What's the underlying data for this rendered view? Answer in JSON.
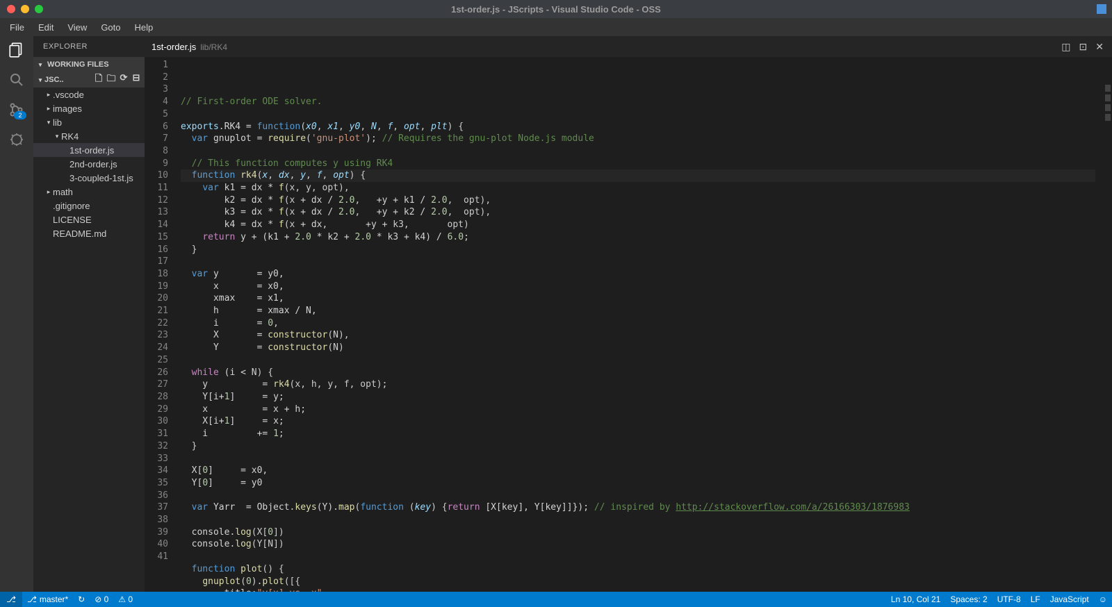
{
  "os_title": "1st-order.js - JScripts - Visual Studio Code - OSS",
  "menu": [
    "File",
    "Edit",
    "View",
    "Goto",
    "Help"
  ],
  "activity_badge": "2",
  "sidebar": {
    "title": "EXPLORER",
    "working_files": "WORKING FILES",
    "root_name": "JSC..",
    "tree": [
      {
        "label": ".vscode",
        "depth": 1,
        "tw": "▸",
        "sel": false
      },
      {
        "label": "images",
        "depth": 1,
        "tw": "▸",
        "sel": false
      },
      {
        "label": "lib",
        "depth": 1,
        "tw": "▾",
        "sel": false
      },
      {
        "label": "RK4",
        "depth": 2,
        "tw": "▾",
        "sel": false
      },
      {
        "label": "1st-order.js",
        "depth": 3,
        "tw": "",
        "sel": true
      },
      {
        "label": "2nd-order.js",
        "depth": 3,
        "tw": "",
        "sel": false
      },
      {
        "label": "3-coupled-1st.js",
        "depth": 3,
        "tw": "",
        "sel": false
      },
      {
        "label": "math",
        "depth": 1,
        "tw": "▸",
        "sel": false
      },
      {
        "label": ".gitignore",
        "depth": 1,
        "tw": "",
        "sel": false
      },
      {
        "label": "LICENSE",
        "depth": 1,
        "tw": "",
        "sel": false
      },
      {
        "label": "README.md",
        "depth": 1,
        "tw": "",
        "sel": false
      }
    ]
  },
  "tab": {
    "name": "1st-order.js",
    "path": "lib/RK4"
  },
  "highlight_line": 10,
  "code_lines": 41,
  "code": [
    [
      {
        "t": "// First-order ODE solver.",
        "c": "c-comment"
      }
    ],
    [],
    [
      {
        "t": "exports",
        "c": "c-var"
      },
      {
        "t": ".RK4 = ",
        "c": "c-op"
      },
      {
        "t": "function",
        "c": "c-kw2"
      },
      {
        "t": "(",
        "c": "c-punc"
      },
      {
        "t": "x0",
        "c": "c-param"
      },
      {
        "t": ", ",
        "c": "c-punc"
      },
      {
        "t": "x1",
        "c": "c-param"
      },
      {
        "t": ", ",
        "c": "c-punc"
      },
      {
        "t": "y0",
        "c": "c-param"
      },
      {
        "t": ", ",
        "c": "c-punc"
      },
      {
        "t": "N",
        "c": "c-param"
      },
      {
        "t": ", ",
        "c": "c-punc"
      },
      {
        "t": "f",
        "c": "c-param"
      },
      {
        "t": ", ",
        "c": "c-punc"
      },
      {
        "t": "opt",
        "c": "c-param"
      },
      {
        "t": ", ",
        "c": "c-punc"
      },
      {
        "t": "plt",
        "c": "c-param"
      },
      {
        "t": ") {",
        "c": "c-punc"
      }
    ],
    [
      {
        "t": "  ",
        "c": ""
      },
      {
        "t": "var",
        "c": "c-kw2"
      },
      {
        "t": " gnuplot = ",
        "c": "c-op"
      },
      {
        "t": "require",
        "c": "c-fn"
      },
      {
        "t": "(",
        "c": "c-punc"
      },
      {
        "t": "'gnu-plot'",
        "c": "c-str"
      },
      {
        "t": "); ",
        "c": "c-punc"
      },
      {
        "t": "// Requires the gnu-plot Node.js module",
        "c": "c-comment"
      }
    ],
    [],
    [
      {
        "t": "  ",
        "c": ""
      },
      {
        "t": "// This function computes y using RK4",
        "c": "c-comment"
      }
    ],
    [
      {
        "t": "  ",
        "c": ""
      },
      {
        "t": "function",
        "c": "c-kw2"
      },
      {
        "t": " ",
        "c": ""
      },
      {
        "t": "rk4",
        "c": "c-fn"
      },
      {
        "t": "(",
        "c": "c-punc"
      },
      {
        "t": "x",
        "c": "c-param"
      },
      {
        "t": ", ",
        "c": "c-punc"
      },
      {
        "t": "dx",
        "c": "c-param"
      },
      {
        "t": ", ",
        "c": "c-punc"
      },
      {
        "t": "y",
        "c": "c-param"
      },
      {
        "t": ", ",
        "c": "c-punc"
      },
      {
        "t": "f",
        "c": "c-param"
      },
      {
        "t": ", ",
        "c": "c-punc"
      },
      {
        "t": "opt",
        "c": "c-param"
      },
      {
        "t": ") {",
        "c": "c-punc"
      }
    ],
    [
      {
        "t": "    ",
        "c": ""
      },
      {
        "t": "var",
        "c": "c-kw2"
      },
      {
        "t": " k1 = dx ",
        "c": "c-op"
      },
      {
        "t": "*",
        "c": "c-op"
      },
      {
        "t": " ",
        "c": ""
      },
      {
        "t": "f",
        "c": "c-fn"
      },
      {
        "t": "(x, y, opt),",
        "c": "c-punc"
      }
    ],
    [
      {
        "t": "        k2 = dx ",
        "c": "c-op"
      },
      {
        "t": "*",
        "c": "c-op"
      },
      {
        "t": " ",
        "c": ""
      },
      {
        "t": "f",
        "c": "c-fn"
      },
      {
        "t": "(x ",
        "c": "c-punc"
      },
      {
        "t": "+",
        "c": "c-op"
      },
      {
        "t": " dx ",
        "c": "c-op"
      },
      {
        "t": "/",
        "c": "c-op"
      },
      {
        "t": " ",
        "c": ""
      },
      {
        "t": "2.0",
        "c": "c-num"
      },
      {
        "t": ",   ",
        "c": "c-punc"
      },
      {
        "t": "+",
        "c": "c-op"
      },
      {
        "t": "y ",
        "c": "c-op"
      },
      {
        "t": "+",
        "c": "c-op"
      },
      {
        "t": " k1 ",
        "c": "c-op"
      },
      {
        "t": "/",
        "c": "c-op"
      },
      {
        "t": " ",
        "c": ""
      },
      {
        "t": "2.0",
        "c": "c-num"
      },
      {
        "t": ",  opt),",
        "c": "c-punc"
      }
    ],
    [
      {
        "t": "        k3 = dx ",
        "c": "c-op"
      },
      {
        "t": "*",
        "c": "c-op"
      },
      {
        "t": " ",
        "c": ""
      },
      {
        "t": "f",
        "c": "c-fn"
      },
      {
        "t": "(x ",
        "c": "c-punc"
      },
      {
        "t": "+",
        "c": "c-op"
      },
      {
        "t": " dx ",
        "c": "c-op"
      },
      {
        "t": "/",
        "c": "c-op"
      },
      {
        "t": " ",
        "c": ""
      },
      {
        "t": "2.0",
        "c": "c-num"
      },
      {
        "t": ",   ",
        "c": "c-punc"
      },
      {
        "t": "+",
        "c": "c-op"
      },
      {
        "t": "y ",
        "c": "c-op"
      },
      {
        "t": "+",
        "c": "c-op"
      },
      {
        "t": " k2 ",
        "c": "c-op"
      },
      {
        "t": "/",
        "c": "c-op"
      },
      {
        "t": " ",
        "c": ""
      },
      {
        "t": "2.0",
        "c": "c-num"
      },
      {
        "t": ",  opt),",
        "c": "c-punc"
      }
    ],
    [
      {
        "t": "        k4 = dx ",
        "c": "c-op"
      },
      {
        "t": "*",
        "c": "c-op"
      },
      {
        "t": " ",
        "c": ""
      },
      {
        "t": "f",
        "c": "c-fn"
      },
      {
        "t": "(x ",
        "c": "c-punc"
      },
      {
        "t": "+",
        "c": "c-op"
      },
      {
        "t": " dx,       ",
        "c": "c-op"
      },
      {
        "t": "+",
        "c": "c-op"
      },
      {
        "t": "y ",
        "c": "c-op"
      },
      {
        "t": "+",
        "c": "c-op"
      },
      {
        "t": " k3,       opt)",
        "c": "c-punc"
      }
    ],
    [
      {
        "t": "    ",
        "c": ""
      },
      {
        "t": "return",
        "c": "c-kw"
      },
      {
        "t": " y ",
        "c": "c-op"
      },
      {
        "t": "+",
        "c": "c-op"
      },
      {
        "t": " (k1 ",
        "c": "c-op"
      },
      {
        "t": "+",
        "c": "c-op"
      },
      {
        "t": " ",
        "c": ""
      },
      {
        "t": "2.0",
        "c": "c-num"
      },
      {
        "t": " ",
        "c": ""
      },
      {
        "t": "*",
        "c": "c-op"
      },
      {
        "t": " k2 ",
        "c": "c-op"
      },
      {
        "t": "+",
        "c": "c-op"
      },
      {
        "t": " ",
        "c": ""
      },
      {
        "t": "2.0",
        "c": "c-num"
      },
      {
        "t": " ",
        "c": ""
      },
      {
        "t": "*",
        "c": "c-op"
      },
      {
        "t": " k3 ",
        "c": "c-op"
      },
      {
        "t": "+",
        "c": "c-op"
      },
      {
        "t": " k4) ",
        "c": "c-op"
      },
      {
        "t": "/",
        "c": "c-op"
      },
      {
        "t": " ",
        "c": ""
      },
      {
        "t": "6.0",
        "c": "c-num"
      },
      {
        "t": ";",
        "c": "c-punc"
      }
    ],
    [
      {
        "t": "  }",
        "c": "c-punc"
      }
    ],
    [],
    [
      {
        "t": "  ",
        "c": ""
      },
      {
        "t": "var",
        "c": "c-kw2"
      },
      {
        "t": " y       = y0,",
        "c": "c-op"
      }
    ],
    [
      {
        "t": "      x       = x0,",
        "c": "c-op"
      }
    ],
    [
      {
        "t": "      xmax    = x1,",
        "c": "c-op"
      }
    ],
    [
      {
        "t": "      h       = xmax ",
        "c": "c-op"
      },
      {
        "t": "/",
        "c": "c-op"
      },
      {
        "t": " N,",
        "c": "c-op"
      }
    ],
    [
      {
        "t": "      i       = ",
        "c": "c-op"
      },
      {
        "t": "0",
        "c": "c-num"
      },
      {
        "t": ",",
        "c": "c-punc"
      }
    ],
    [
      {
        "t": "      X       = ",
        "c": "c-op"
      },
      {
        "t": "constructor",
        "c": "c-fn"
      },
      {
        "t": "(N),",
        "c": "c-punc"
      }
    ],
    [
      {
        "t": "      Y       = ",
        "c": "c-op"
      },
      {
        "t": "constructor",
        "c": "c-fn"
      },
      {
        "t": "(N)",
        "c": "c-punc"
      }
    ],
    [],
    [
      {
        "t": "  ",
        "c": ""
      },
      {
        "t": "while",
        "c": "c-kw"
      },
      {
        "t": " (i ",
        "c": "c-op"
      },
      {
        "t": "<",
        "c": "c-op"
      },
      {
        "t": " N) {",
        "c": "c-punc"
      }
    ],
    [
      {
        "t": "    y          = ",
        "c": "c-op"
      },
      {
        "t": "rk4",
        "c": "c-fn"
      },
      {
        "t": "(x, h, y, f, opt);",
        "c": "c-punc"
      }
    ],
    [
      {
        "t": "    Y[i",
        "c": "c-op"
      },
      {
        "t": "+",
        "c": "c-op"
      },
      {
        "t": "1",
        "c": "c-num"
      },
      {
        "t": "]     = y;",
        "c": "c-op"
      }
    ],
    [
      {
        "t": "    x          = x ",
        "c": "c-op"
      },
      {
        "t": "+",
        "c": "c-op"
      },
      {
        "t": " h;",
        "c": "c-op"
      }
    ],
    [
      {
        "t": "    X[i",
        "c": "c-op"
      },
      {
        "t": "+",
        "c": "c-op"
      },
      {
        "t": "1",
        "c": "c-num"
      },
      {
        "t": "]     = x;",
        "c": "c-op"
      }
    ],
    [
      {
        "t": "    i         ",
        "c": "c-op"
      },
      {
        "t": "+=",
        "c": "c-op"
      },
      {
        "t": " ",
        "c": ""
      },
      {
        "t": "1",
        "c": "c-num"
      },
      {
        "t": ";",
        "c": "c-punc"
      }
    ],
    [
      {
        "t": "  }",
        "c": "c-punc"
      }
    ],
    [],
    [
      {
        "t": "  X[",
        "c": "c-op"
      },
      {
        "t": "0",
        "c": "c-num"
      },
      {
        "t": "]     = x0,",
        "c": "c-op"
      }
    ],
    [
      {
        "t": "  Y[",
        "c": "c-op"
      },
      {
        "t": "0",
        "c": "c-num"
      },
      {
        "t": "]     = y0",
        "c": "c-op"
      }
    ],
    [],
    [
      {
        "t": "  ",
        "c": ""
      },
      {
        "t": "var",
        "c": "c-kw2"
      },
      {
        "t": " Yarr  = Object.",
        "c": "c-op"
      },
      {
        "t": "keys",
        "c": "c-fn"
      },
      {
        "t": "(Y).",
        "c": "c-op"
      },
      {
        "t": "map",
        "c": "c-fn"
      },
      {
        "t": "(",
        "c": "c-punc"
      },
      {
        "t": "function",
        "c": "c-kw2"
      },
      {
        "t": " (",
        "c": "c-punc"
      },
      {
        "t": "key",
        "c": "c-param"
      },
      {
        "t": ") {",
        "c": "c-punc"
      },
      {
        "t": "return",
        "c": "c-kw"
      },
      {
        "t": " [X[key], Y[key]]}); ",
        "c": "c-op"
      },
      {
        "t": "// inspired by ",
        "c": "c-comment"
      },
      {
        "t": "http://stackoverflow.com/a/26166303/1876983",
        "c": "c-link"
      }
    ],
    [],
    [
      {
        "t": "  console.",
        "c": "c-op"
      },
      {
        "t": "log",
        "c": "c-fn"
      },
      {
        "t": "(X[",
        "c": "c-punc"
      },
      {
        "t": "0",
        "c": "c-num"
      },
      {
        "t": "])",
        "c": "c-punc"
      }
    ],
    [
      {
        "t": "  console.",
        "c": "c-op"
      },
      {
        "t": "log",
        "c": "c-fn"
      },
      {
        "t": "(Y[N])",
        "c": "c-punc"
      }
    ],
    [],
    [
      {
        "t": "  ",
        "c": ""
      },
      {
        "t": "function",
        "c": "c-kw2"
      },
      {
        "t": " ",
        "c": ""
      },
      {
        "t": "plot",
        "c": "c-fn"
      },
      {
        "t": "() {",
        "c": "c-punc"
      }
    ],
    [
      {
        "t": "    ",
        "c": ""
      },
      {
        "t": "gnuplot",
        "c": "c-fn"
      },
      {
        "t": "(",
        "c": "c-punc"
      },
      {
        "t": "0",
        "c": "c-num"
      },
      {
        "t": ").",
        "c": "c-op"
      },
      {
        "t": "plot",
        "c": "c-fn"
      },
      {
        "t": "([{",
        "c": "c-punc"
      }
    ],
    [
      {
        "t": "        title:",
        "c": "c-op"
      },
      {
        "t": "\"y[x] vs. x\"",
        "c": "c-str"
      },
      {
        "t": ",",
        "c": "c-punc"
      }
    ]
  ],
  "status": {
    "branch": "master*",
    "sync": "↻",
    "errors": "⊘ 0",
    "warnings": "⚠ 0",
    "ln_col": "Ln 10, Col 21",
    "spaces": "Spaces: 2",
    "encoding": "UTF-8",
    "eol": "LF",
    "lang": "JavaScript",
    "feedback": "☺"
  }
}
